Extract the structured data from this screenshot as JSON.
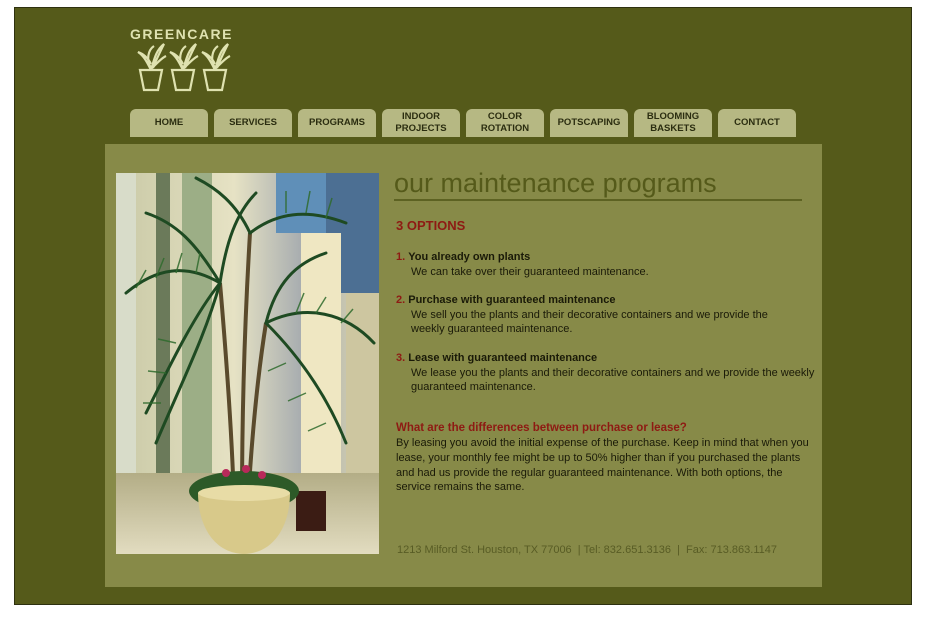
{
  "brand": {
    "name": "GREENCARE",
    "logo_icon": "potted-plants-icon",
    "logo_color": "#dfe2b0"
  },
  "colors": {
    "frame": "#555a1a",
    "panel": "#878a48",
    "tab": "#b6b883",
    "accent": "#8e1a13"
  },
  "nav": {
    "tabs": [
      {
        "label": "HOME"
      },
      {
        "label": "SERVICES"
      },
      {
        "label": "PROGRAMS"
      },
      {
        "label": "INDOOR\nPROJECTS"
      },
      {
        "label": "COLOR\nROTATION"
      },
      {
        "label": "POTSCAPING"
      },
      {
        "label": "BLOOMING\nBASKETS"
      },
      {
        "label": "CONTACT"
      }
    ]
  },
  "main": {
    "heading": "our maintenance programs",
    "options_title": "3 OPTIONS",
    "options": [
      {
        "num": "1.",
        "title": "You already own plants",
        "desc": "We can take over their guaranteed maintenance."
      },
      {
        "num": "2.",
        "title": "Purchase with guaranteed maintenance",
        "desc": "We sell you the plants and their decorative containers and we provide the weekly guaranteed maintenance."
      },
      {
        "num": "3.",
        "title": "Lease with guaranteed maintenance",
        "desc": "We lease you the plants and their decorative containers and we provide the weekly guaranteed maintenance."
      }
    ],
    "diff_title": "What are the differences between purchase or lease?",
    "diff_text": "By leasing you avoid the initial expense of the purchase. Keep in mind that when you lease, your monthly fee might be up to 50% higher than if you purchased the plants and had us provide the regular guaranteed maintenance. With both options, the service remains the same.",
    "footer": "1213 Milford St. Houston, TX 77006  | Tel: 832.651.3136  |  Fax: 713.863.1147"
  },
  "photo": {
    "subject": "palm-plant-in-planter-image"
  }
}
